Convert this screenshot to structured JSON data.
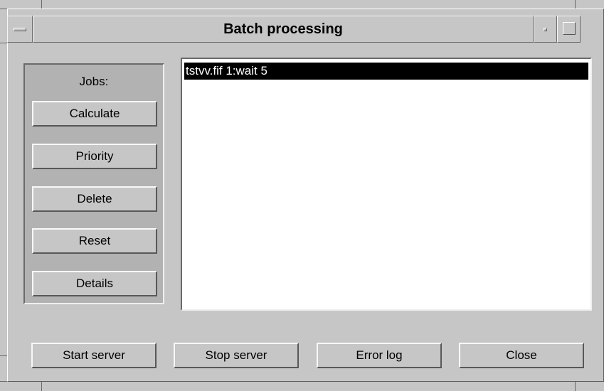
{
  "window": {
    "title": "Batch processing"
  },
  "jobs": {
    "label": "Jobs:",
    "buttons": [
      "Calculate",
      "Priority",
      "Delete",
      "Reset",
      "Details"
    ]
  },
  "job_list": {
    "items": [
      {
        "text": "tstvv.fif 1:wait 5",
        "selected": true
      }
    ]
  },
  "bottom_buttons": [
    "Start server",
    "Stop server",
    "Error log",
    "Close"
  ]
}
